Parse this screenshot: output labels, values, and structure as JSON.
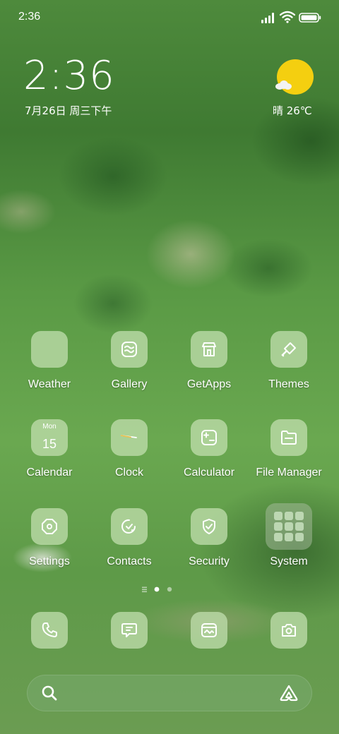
{
  "status_bar": {
    "time": "2:36"
  },
  "lock_clock": {
    "time": "2:36",
    "date": "7月26日 周三下午"
  },
  "weather_widget": {
    "text": "晴 26℃",
    "sun_color": "#f4cf10"
  },
  "apps": [
    {
      "label": "Weather",
      "icon": "weather-icon"
    },
    {
      "label": "Gallery",
      "icon": "gallery-icon"
    },
    {
      "label": "GetApps",
      "icon": "store-icon"
    },
    {
      "label": "Themes",
      "icon": "brush-icon"
    },
    {
      "label": "Calendar",
      "icon": "calendar-icon",
      "day": "Mon",
      "date": "15"
    },
    {
      "label": "Clock",
      "icon": "clock-icon"
    },
    {
      "label": "Calculator",
      "icon": "calculator-icon"
    },
    {
      "label": "File Manager",
      "icon": "folder-icon"
    },
    {
      "label": "Settings",
      "icon": "gear-icon"
    },
    {
      "label": "Contacts",
      "icon": "contacts-icon"
    },
    {
      "label": "Security",
      "icon": "shield-icon"
    },
    {
      "label": "System",
      "icon": "folder-grid-icon"
    }
  ],
  "dock": [
    {
      "icon": "phone-icon"
    },
    {
      "icon": "message-icon"
    },
    {
      "icon": "browser-icon"
    },
    {
      "icon": "camera-icon"
    }
  ],
  "page_indicator": {
    "pages": 2,
    "current": 1
  },
  "search_bar": {
    "left_icon": "search-icon",
    "right_icon": "assistant-icon"
  },
  "colors": {
    "tile": "#bedcaa",
    "text": "#ffffff"
  }
}
